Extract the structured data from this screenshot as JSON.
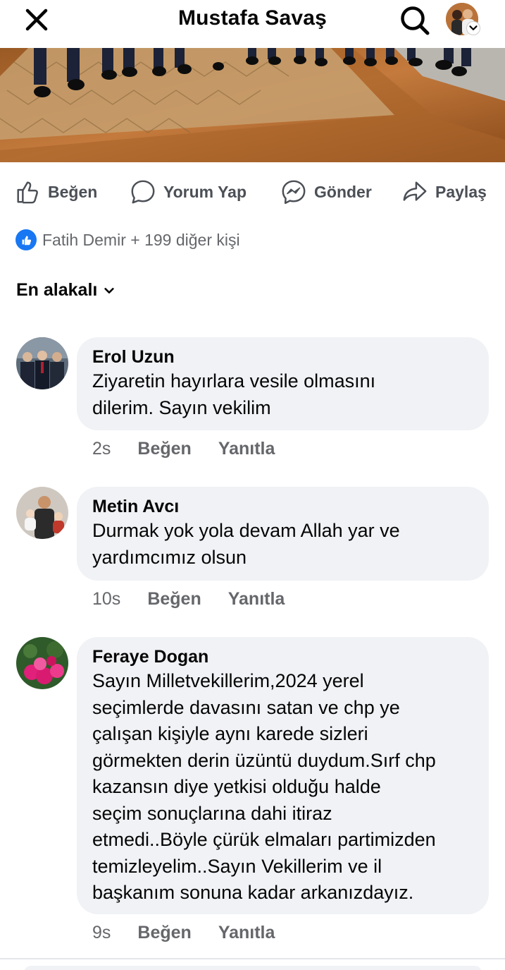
{
  "header": {
    "title": "Mustafa Savaş",
    "close_icon": "close-icon",
    "search_icon": "search-icon"
  },
  "actions": {
    "like": "Beğen",
    "comment": "Yorum Yap",
    "send": "Gönder",
    "share": "Paylaş"
  },
  "reactions": {
    "text": "Fatih Demir + 199 diğer kişi"
  },
  "sort": {
    "label": "En alakalı"
  },
  "comments": [
    {
      "name": "Erol Uzun",
      "lines": [
        "Ziyaretin hayırlara vesile olmasını",
        "dilerim. Sayın vekilim"
      ],
      "time": "2s",
      "like": "Beğen",
      "reply": "Yanıtla"
    },
    {
      "name": "Metin Avcı",
      "lines": [
        "Durmak yok yola devam Allah yar ve",
        "yardımcımız olsun"
      ],
      "time": "10s",
      "like": "Beğen",
      "reply": "Yanıtla"
    },
    {
      "name": "Feraye Dogan",
      "lines": [
        "Sayın Milletvekillerim,2024 yerel",
        "seçimlerde davasını satan ve chp ye",
        "çalışan kişiyle  aynı karede sizleri",
        "görmekten derin üzüntü duydum.Sırf chp",
        "kazansın diye yetkisi olduğu halde",
        "seçim sonuçlarına dahi itiraz",
        "etmedi..Böyle çürük elmaları partimizden",
        "temizleyelim..Sayın Vekillerim ve il",
        "başkanım sonuna kadar arkanızdayız."
      ],
      "time": "9s",
      "like": "Beğen",
      "reply": "Yanıtla"
    }
  ],
  "colors": {
    "accent": "#1877f2",
    "bubble": "#f0f2f5",
    "secondary_text": "#65676b"
  }
}
